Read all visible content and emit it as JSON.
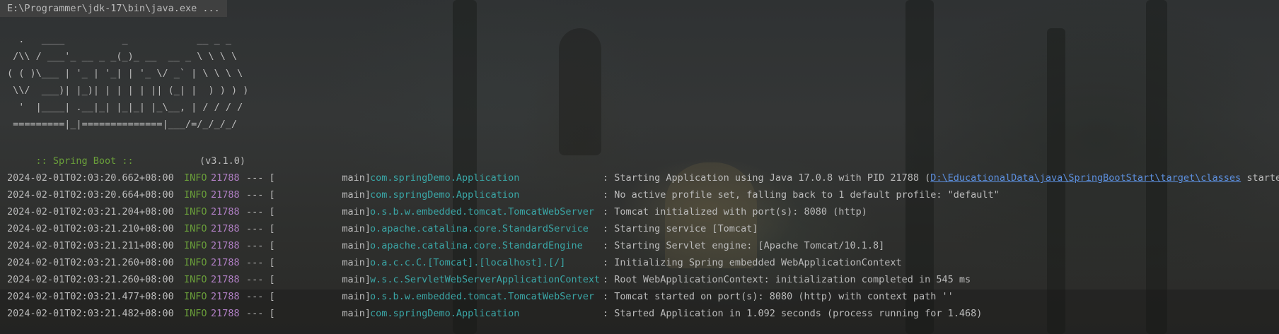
{
  "command_line": "E:\\Programmer\\jdk-17\\bin\\java.exe ...",
  "banner": {
    "ascii_art": "  .   ____          _            __ _ _\n /\\\\ / ___'_ __ _ _(_)_ __  __ _ \\ \\ \\ \\\n( ( )\\___ | '_ | '_| | '_ \\/ _` | \\ \\ \\ \\\n \\\\/  ___)| |_)| | | | | || (_| |  ) ) ) )\n  '  |____| .__|_| |_|_| |_\\__, | / / / /\n =========|_|==============|___/=/_/_/_/",
    "spring_boot_label": ":: Spring Boot ::",
    "version": "(v3.1.0)"
  },
  "log_lines": [
    {
      "timestamp": "2024-02-01T02:03:20.662+08:00",
      "level": "INFO",
      "pid": "21788",
      "separator": "--- [",
      "thread": "main]",
      "logger": "com.springDemo.Application",
      "message": ": Starting Application using Java 17.0.8 with PID 21788 (",
      "link": "D:\\EducationalData\\java\\SpringBootStart\\target\\classes",
      "message_tail": " started"
    },
    {
      "timestamp": "2024-02-01T02:03:20.664+08:00",
      "level": "INFO",
      "pid": "21788",
      "separator": "--- [",
      "thread": "main]",
      "logger": "com.springDemo.Application",
      "message": ": No active profile set, falling back to 1 default profile: \"default\""
    },
    {
      "timestamp": "2024-02-01T02:03:21.204+08:00",
      "level": "INFO",
      "pid": "21788",
      "separator": "--- [",
      "thread": "main]",
      "logger": "o.s.b.w.embedded.tomcat.TomcatWebServer",
      "message": ": Tomcat initialized with port(s): 8080 (http)"
    },
    {
      "timestamp": "2024-02-01T02:03:21.210+08:00",
      "level": "INFO",
      "pid": "21788",
      "separator": "--- [",
      "thread": "main]",
      "logger": "o.apache.catalina.core.StandardService",
      "message": ": Starting service [Tomcat]"
    },
    {
      "timestamp": "2024-02-01T02:03:21.211+08:00",
      "level": "INFO",
      "pid": "21788",
      "separator": "--- [",
      "thread": "main]",
      "logger": "o.apache.catalina.core.StandardEngine",
      "message": ": Starting Servlet engine: [Apache Tomcat/10.1.8]"
    },
    {
      "timestamp": "2024-02-01T02:03:21.260+08:00",
      "level": "INFO",
      "pid": "21788",
      "separator": "--- [",
      "thread": "main]",
      "logger": "o.a.c.c.C.[Tomcat].[localhost].[/]",
      "message": ": Initializing Spring embedded WebApplicationContext"
    },
    {
      "timestamp": "2024-02-01T02:03:21.260+08:00",
      "level": "INFO",
      "pid": "21788",
      "separator": "--- [",
      "thread": "main]",
      "logger": "w.s.c.ServletWebServerApplicationContext",
      "message": ": Root WebApplicationContext: initialization completed in 545 ms"
    },
    {
      "timestamp": "2024-02-01T02:03:21.477+08:00",
      "level": "INFO",
      "pid": "21788",
      "separator": "--- [",
      "thread": "main]",
      "logger": "o.s.b.w.embedded.tomcat.TomcatWebServer",
      "message": ": Tomcat started on port(s): 8080 (http) with context path ''"
    },
    {
      "timestamp": "2024-02-01T02:03:21.482+08:00",
      "level": "INFO",
      "pid": "21788",
      "separator": "--- [",
      "thread": "main]",
      "logger": "com.springDemo.Application",
      "message": ": Started Application in 1.092 seconds (process running for 1.468)"
    }
  ],
  "colors": {
    "background": "#2b2b2b",
    "text": "#bbbbbb",
    "info_level": "#6a9f3a",
    "pid": "#b07fc4",
    "logger": "#3aa6a6",
    "link": "#5c8fde",
    "spring_label": "#6a9f3a"
  }
}
